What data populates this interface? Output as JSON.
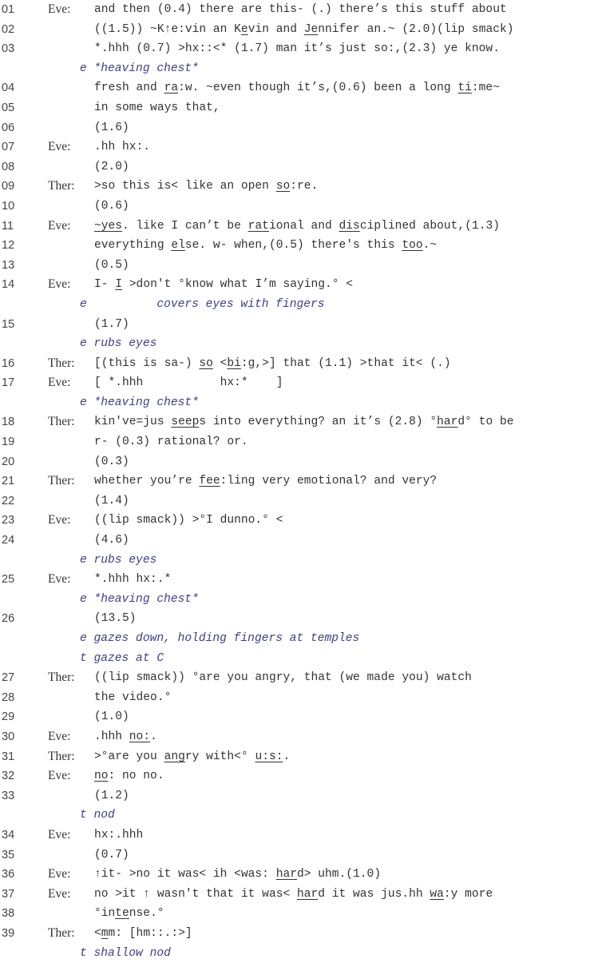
{
  "transcript": [
    {
      "type": "line",
      "num": "01",
      "speaker": "Eve:",
      "segments": [
        {
          "t": "and then (0.4) there are this- (.) there’s this stuff about"
        }
      ]
    },
    {
      "type": "line",
      "num": "02",
      "speaker": "",
      "segments": [
        {
          "t": "((1.5)) ~K↑e:vin an K"
        },
        {
          "t": "e",
          "u": true
        },
        {
          "t": "vin and "
        },
        {
          "t": "Je",
          "u": true
        },
        {
          "t": "nnifer an.~ (2.0)(lip smack)"
        }
      ]
    },
    {
      "type": "line",
      "num": "03",
      "speaker": "",
      "segments": [
        {
          "t": "*.hhh (0.7) >hx::<* (1.7) man it’s just so:,(2.3) ye know."
        }
      ]
    },
    {
      "type": "annotation",
      "text": "e *heaving chest*"
    },
    {
      "type": "line",
      "num": "04",
      "speaker": "",
      "segments": [
        {
          "t": "fresh and "
        },
        {
          "t": "ra",
          "u": true
        },
        {
          "t": ":w. ~even though it’s,(0.6) been a long "
        },
        {
          "t": "ti",
          "u": true
        },
        {
          "t": ":me~"
        }
      ]
    },
    {
      "type": "line",
      "num": "05",
      "speaker": "",
      "segments": [
        {
          "t": "in some ways that,"
        }
      ]
    },
    {
      "type": "line",
      "num": "06",
      "speaker": "",
      "segments": [
        {
          "t": "(1.6)"
        }
      ]
    },
    {
      "type": "line",
      "num": "07",
      "speaker": "Eve:",
      "segments": [
        {
          "t": ".hh hx:."
        }
      ]
    },
    {
      "type": "line",
      "num": "08",
      "speaker": "",
      "segments": [
        {
          "t": "(2.0)"
        }
      ]
    },
    {
      "type": "line",
      "num": "09",
      "speaker": "Ther:",
      "segments": [
        {
          "t": ">so this is< like an open "
        },
        {
          "t": "so",
          "u": true
        },
        {
          "t": ":re."
        }
      ]
    },
    {
      "type": "line",
      "num": "10",
      "speaker": "",
      "segments": [
        {
          "t": "(0.6)"
        }
      ]
    },
    {
      "type": "line",
      "num": "11",
      "speaker": "Eve:",
      "segments": [
        {
          "t": "~yes",
          "u": true
        },
        {
          "t": ". like I can’t be "
        },
        {
          "t": "rat",
          "u": true
        },
        {
          "t": "ional and "
        },
        {
          "t": "dis",
          "u": true
        },
        {
          "t": "ciplined about,(1.3)"
        }
      ]
    },
    {
      "type": "line",
      "num": "12",
      "speaker": "",
      "segments": [
        {
          "t": "everything "
        },
        {
          "t": "el",
          "u": true
        },
        {
          "t": "se. w- when,(0.5) there's this "
        },
        {
          "t": "too",
          "u": true
        },
        {
          "t": ".~"
        }
      ]
    },
    {
      "type": "line",
      "num": "13",
      "speaker": "",
      "segments": [
        {
          "t": "(0.5)"
        }
      ]
    },
    {
      "type": "line",
      "num": "14",
      "speaker": "Eve:",
      "segments": [
        {
          "t": "I- "
        },
        {
          "t": "I",
          "u": true
        },
        {
          "t": " >don't °know what I’m saying.° <"
        }
      ]
    },
    {
      "type": "annotation",
      "text": "e          covers eyes with fingers"
    },
    {
      "type": "line",
      "num": "15",
      "speaker": "",
      "segments": [
        {
          "t": "(1.7)"
        }
      ]
    },
    {
      "type": "annotation",
      "text": "e rubs eyes"
    },
    {
      "type": "line",
      "num": "16",
      "speaker": "Ther:",
      "segments": [
        {
          "t": "[(this is sa-) "
        },
        {
          "t": "so",
          "u": true
        },
        {
          "t": " <"
        },
        {
          "t": "bi",
          "u": true
        },
        {
          "t": ":g,>] that (1.1) >that it< (.)"
        }
      ]
    },
    {
      "type": "line",
      "num": "17",
      "speaker": "Eve:",
      "segments": [
        {
          "t": "[ *.hhh           hx:*    ]"
        }
      ]
    },
    {
      "type": "annotation",
      "text": "e *heaving chest*"
    },
    {
      "type": "line",
      "num": "18",
      "speaker": "Ther:",
      "segments": [
        {
          "t": "kin've=jus "
        },
        {
          "t": "seep",
          "u": true
        },
        {
          "t": "s into everything? an it’s (2.8) °"
        },
        {
          "t": "har",
          "u": true
        },
        {
          "t": "d° to be"
        }
      ]
    },
    {
      "type": "line",
      "num": "19",
      "speaker": "",
      "segments": [
        {
          "t": "r- (0.3) rational? or."
        }
      ]
    },
    {
      "type": "line",
      "num": "20",
      "speaker": "",
      "segments": [
        {
          "t": "(0.3)"
        }
      ]
    },
    {
      "type": "line",
      "num": "21",
      "speaker": "Ther:",
      "segments": [
        {
          "t": "whether you’re "
        },
        {
          "t": "fee",
          "u": true
        },
        {
          "t": ":ling very emotional? and very?"
        }
      ]
    },
    {
      "type": "line",
      "num": "22",
      "speaker": "",
      "segments": [
        {
          "t": "(1.4)"
        }
      ]
    },
    {
      "type": "line",
      "num": "23",
      "speaker": "Eve:",
      "segments": [
        {
          "t": "((lip smack)) >°I dunno.° <"
        }
      ]
    },
    {
      "type": "line",
      "num": "24",
      "speaker": "",
      "segments": [
        {
          "t": "(4.6)"
        }
      ]
    },
    {
      "type": "annotation",
      "text": "e rubs eyes"
    },
    {
      "type": "line",
      "num": "25",
      "speaker": "Eve:",
      "segments": [
        {
          "t": "*.hhh hx:.*"
        }
      ]
    },
    {
      "type": "annotation",
      "text": "e *heaving chest*"
    },
    {
      "type": "line",
      "num": "26",
      "speaker": "",
      "segments": [
        {
          "t": "(13.5)"
        }
      ]
    },
    {
      "type": "annotation",
      "text": "e gazes down, holding fingers at temples"
    },
    {
      "type": "annotation",
      "text": "t gazes at C"
    },
    {
      "type": "line",
      "num": "27",
      "speaker": "Ther:",
      "segments": [
        {
          "t": "((lip smack)) °are you angry, that (we made you) watch"
        }
      ]
    },
    {
      "type": "line",
      "num": "28",
      "speaker": "",
      "segments": [
        {
          "t": "the video.°"
        }
      ]
    },
    {
      "type": "line",
      "num": "29",
      "speaker": "",
      "segments": [
        {
          "t": "(1.0)"
        }
      ]
    },
    {
      "type": "line",
      "num": "30",
      "speaker": "Eve:",
      "segments": [
        {
          "t": ".hhh "
        },
        {
          "t": "no:",
          "u": true
        },
        {
          "t": "."
        }
      ]
    },
    {
      "type": "line",
      "num": "31",
      "speaker": "Ther:",
      "segments": [
        {
          "t": ">°are you "
        },
        {
          "t": "ang",
          "u": true
        },
        {
          "t": "ry with<° "
        },
        {
          "t": "u:s:",
          "u": true
        },
        {
          "t": "."
        }
      ]
    },
    {
      "type": "line",
      "num": "32",
      "speaker": "Eve:",
      "segments": [
        {
          "t": "no",
          "u": true
        },
        {
          "t": ": no no."
        }
      ]
    },
    {
      "type": "line",
      "num": "33",
      "speaker": "",
      "segments": [
        {
          "t": "(1.2)"
        }
      ]
    },
    {
      "type": "annotation",
      "text": "t nod"
    },
    {
      "type": "line",
      "num": "34",
      "speaker": "Eve:",
      "segments": [
        {
          "t": "hx:.hhh"
        }
      ]
    },
    {
      "type": "line",
      "num": "35",
      "speaker": "",
      "segments": [
        {
          "t": "(0.7)"
        }
      ]
    },
    {
      "type": "line",
      "num": "36",
      "speaker": "Eve:",
      "segments": [
        {
          "t": "↑it- >no it was< ih <was: "
        },
        {
          "t": "har",
          "u": true
        },
        {
          "t": "d> uhm.(1.0)"
        }
      ]
    },
    {
      "type": "line",
      "num": "37",
      "speaker": "Eve:",
      "segments": [
        {
          "t": "no >it ↑ wasn't that it was< "
        },
        {
          "t": "har",
          "u": true
        },
        {
          "t": "d it was jus.hh "
        },
        {
          "t": "wa",
          "u": true
        },
        {
          "t": ":y more"
        }
      ]
    },
    {
      "type": "line",
      "num": "38",
      "speaker": "",
      "segments": [
        {
          "t": "°in"
        },
        {
          "t": "te",
          "u": true
        },
        {
          "t": "nse.°"
        }
      ]
    },
    {
      "type": "line",
      "num": "39",
      "speaker": "Ther:",
      "segments": [
        {
          "t": "<"
        },
        {
          "t": "m",
          "u": true
        },
        {
          "t": "m: [hm::.:>]"
        }
      ]
    },
    {
      "type": "annotation",
      "text": "t shallow nod"
    }
  ]
}
